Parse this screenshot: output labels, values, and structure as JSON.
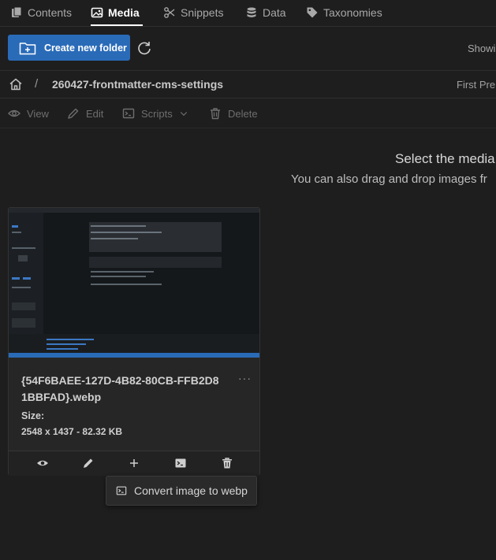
{
  "tabs": [
    {
      "label": "Contents",
      "icon": "files-icon",
      "active": false
    },
    {
      "label": "Media",
      "icon": "image-icon",
      "active": true
    },
    {
      "label": "Snippets",
      "icon": "scissors-icon",
      "active": false
    },
    {
      "label": "Data",
      "icon": "database-icon",
      "active": false
    },
    {
      "label": "Taxonomies",
      "icon": "tag-icon",
      "active": false
    }
  ],
  "toolbar": {
    "create_folder_label": "Create new folder",
    "show_text": "Showi"
  },
  "breadcrumb": {
    "separator": "/",
    "path": "260427-frontmatter-cms-settings",
    "pagination": "First  Pre"
  },
  "actions": {
    "view": "View",
    "edit": "Edit",
    "scripts": "Scripts",
    "delete": "Delete"
  },
  "empty_state": {
    "title": "Select the media",
    "subtitle": "You can also drag and drop images fr"
  },
  "media_card": {
    "filename": "{54F6BAEE-127D-4B82-80CB-FFB2D81BBFAD}.webp",
    "more": "···",
    "size_label": "Size:",
    "size_value": "2548 x 1437 - 82.32 KB"
  },
  "tooltip": {
    "label": "Convert image to webp"
  },
  "colors": {
    "background": "#1e1e1e",
    "primary_button": "#2a6bb8",
    "card": "#262626"
  }
}
